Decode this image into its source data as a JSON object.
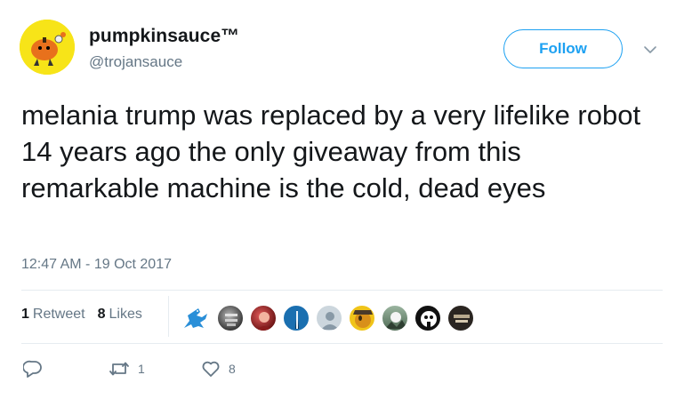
{
  "user": {
    "display_name": "pumpkinsauce™",
    "handle": "@trojansauce",
    "avatar_icon": "pumpkin-character-avatar",
    "avatar_bg": "#f7e418"
  },
  "follow_button": {
    "label": "Follow",
    "color": "#1da1f2"
  },
  "tweet": {
    "text": "melania trump was replaced by a very lifelike robot 14 years ago the only giveaway from this remarkable machine is the cold, dead eyes",
    "timestamp": "12:47 AM - 19 Oct 2017"
  },
  "stats": {
    "retweets_count": "1",
    "retweets_label": "Retweet",
    "likes_count": "8",
    "likes_label": "Likes"
  },
  "likers": [
    "blue-lizard",
    "grey-photo",
    "red-photo",
    "blue-circle-icon",
    "default-user",
    "yellow-cartoon",
    "landscape-photo",
    "black-white-photo",
    "dark-photo"
  ],
  "actions": {
    "reply_count": "",
    "retweet_count": "1",
    "like_count": "8"
  },
  "colors": {
    "text_primary": "#14171a",
    "text_secondary": "#657786",
    "divider": "#e6ecf0"
  }
}
